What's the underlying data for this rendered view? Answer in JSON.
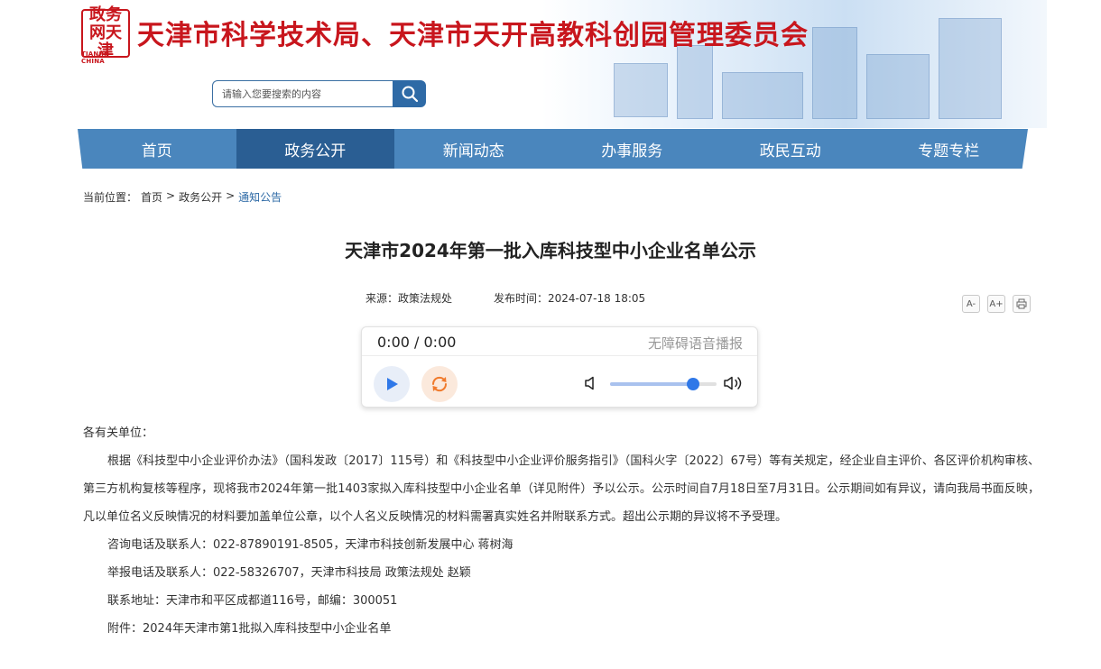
{
  "header": {
    "logo_glyphs": "政务网天津",
    "logo_sub": "TIANJIN CHINA",
    "site_title": "天津市科学技术局、天津市天开高教科创园管理委员会"
  },
  "search": {
    "placeholder": "请输入您要搜索的内容"
  },
  "nav": {
    "items": [
      {
        "label": "首页"
      },
      {
        "label": "政务公开"
      },
      {
        "label": "新闻动态"
      },
      {
        "label": "办事服务"
      },
      {
        "label": "政民互动"
      },
      {
        "label": "专题专栏"
      }
    ],
    "active_index": 1
  },
  "breadcrumb": {
    "prefix": "当前位置：",
    "items": [
      "首页",
      "政务公开",
      "通知公告"
    ],
    "separator": ">"
  },
  "article": {
    "title": "天津市2024年第一批入库科技型中小企业名单公示",
    "source": "来源：政策法规处",
    "published": "发布时间：2024-07-18 18:05",
    "tools": {
      "font_smaller": "A-",
      "font_larger": "A+",
      "print_icon": "print-icon"
    }
  },
  "player": {
    "time": "0:00 / 0:00",
    "label": "无障碍语音播报",
    "volume": 0.78
  },
  "content": {
    "greeting": "各有关单位：",
    "paragraph": "根据《科技型中小企业评价办法》（国科发政〔2017〕115号）和《科技型中小企业评价服务指引》（国科火字〔2022〕67号）等有关规定，经企业自主评价、各区评价机构审核、第三方机构复核等程序，现将我市2024年第一批1403家拟入库科技型中小企业名单（详见附件）予以公示。公示时间自7月18日至7月31日。公示期间如有异议，请向我局书面反映，凡以单位名义反映情况的材料要加盖单位公章，以个人名义反映情况的材料需署真实姓名并附联系方式。超出公示期的异议将不予受理。",
    "consult": "咨询电话及联系人：022-87890191-8505，天津市科技创新发展中心 蒋树海",
    "report": "举报电话及联系人：022-58326707，天津市科技局 政策法规处 赵颖",
    "address": "联系地址：天津市和平区成都道116号，邮编：300051",
    "attachment": "附件：2024年天津市第1批拟入库科技型中小企业名单"
  },
  "colors": {
    "brand_red": "#c8161d",
    "nav_blue": "#4a86bd",
    "nav_active": "#2a5e93",
    "link_blue": "#2e6aa6",
    "play_blue": "#2f78e8",
    "loop_orange": "#f07a2c"
  }
}
